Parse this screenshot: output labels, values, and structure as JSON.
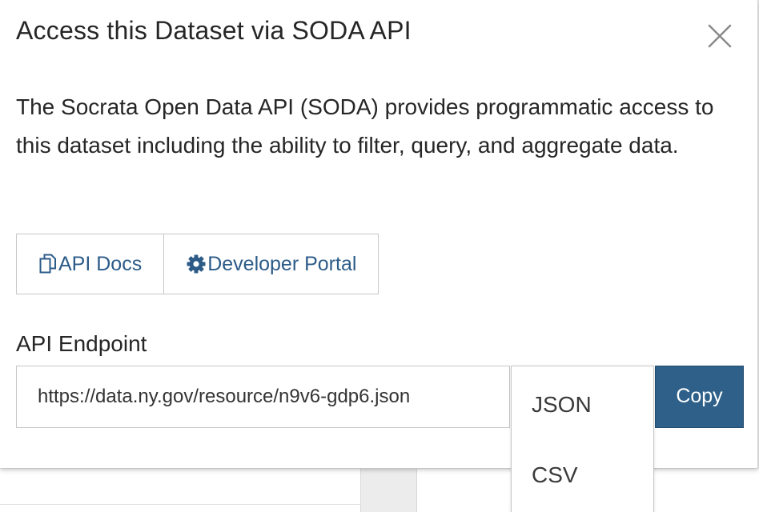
{
  "modal": {
    "title": "Access this Dataset via SODA API",
    "description": "The Socrata Open Data API (SODA) provides programmatic access to this dataset including the ability to filter, query, and aggregate data.",
    "close_icon": "close-icon"
  },
  "links": {
    "api_docs_label": "API Docs",
    "api_docs_icon": "copy-document-icon",
    "developer_portal_label": "Developer Portal",
    "developer_portal_icon": "gear-icon"
  },
  "endpoint": {
    "label": "API Endpoint",
    "value": "https://data.ny.gov/resource/n9v6-gdp6.json",
    "copy_label": "Copy",
    "formats": [
      "JSON",
      "CSV"
    ]
  },
  "colors": {
    "link": "#2c5b88",
    "copy_button": "#2e6089",
    "text": "#262626"
  }
}
